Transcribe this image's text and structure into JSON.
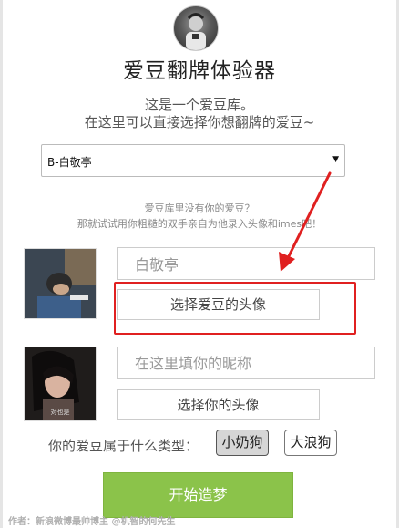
{
  "app": {
    "title": "爱豆翻牌体验器",
    "logo_icon": "avatar-photo-icon"
  },
  "intro": {
    "line1": "这是一个爱豆库。",
    "line2": "在这里可以直接选择你想翻牌的爱豆~"
  },
  "idol_select": {
    "value": "B-白敬亭",
    "caret_icon": "dropdown-caret-icon"
  },
  "hint": {
    "line1": "爱豆库里没有你的爱豆？",
    "line2": "那就试试用你粗糙的双手亲自为他录入头像和imes吧！"
  },
  "idol": {
    "name_value": "白敬亭",
    "choose_avatar_label": "选择爱豆的头像"
  },
  "user": {
    "nickname_placeholder": "在这里填你的昵称",
    "choose_avatar_label": "选择你的头像",
    "photo_caption": "对也是"
  },
  "type": {
    "label": "你的爱豆属于什么类型：",
    "options": [
      "小奶狗",
      "大浪狗"
    ],
    "selected": "小奶狗"
  },
  "start_label": "开始造梦",
  "author": "作者：新浪微博最帅博主 @机智的何先生",
  "colors": {
    "start_button": "#8bc34a",
    "highlight_annotation": "#e02020"
  }
}
